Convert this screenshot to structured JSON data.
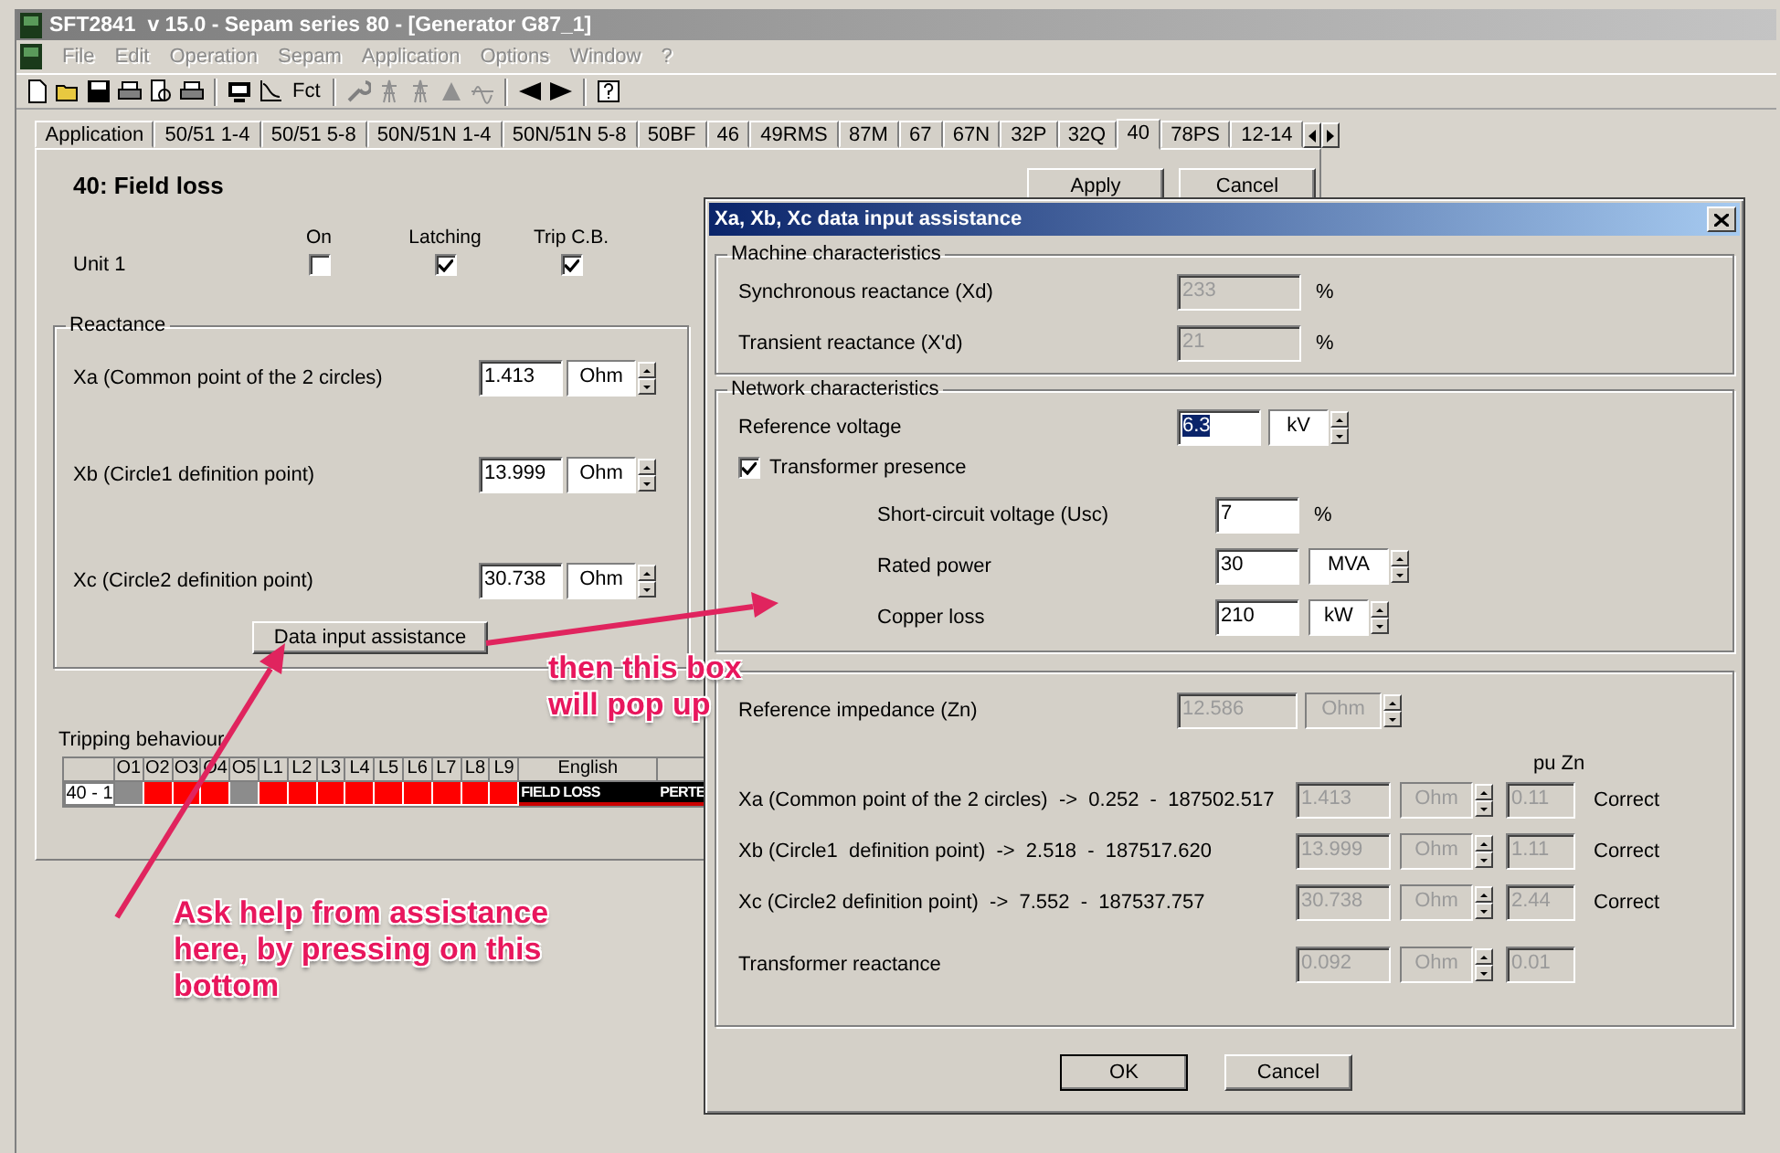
{
  "window": {
    "title": "SFT2841  v 15.0 - Sepam series 80 - [Generator G87_1]"
  },
  "menu": {
    "disabled": true,
    "items": [
      "File",
      "Edit",
      "Operation",
      "Sepam",
      "Application",
      "Options",
      "Window",
      "?"
    ]
  },
  "toolbar": {
    "function_label": "Fct"
  },
  "tabs": [
    {
      "label": "Application",
      "selected": false
    },
    {
      "label": "50/51 1-4",
      "selected": false
    },
    {
      "label": "50/51 5-8",
      "selected": false
    },
    {
      "label": "50N/51N 1-4",
      "selected": false
    },
    {
      "label": "50N/51N 5-8",
      "selected": false
    },
    {
      "label": "50BF",
      "selected": false
    },
    {
      "label": "46",
      "selected": false
    },
    {
      "label": "49RMS",
      "selected": false
    },
    {
      "label": "87M",
      "selected": false
    },
    {
      "label": "67",
      "selected": false
    },
    {
      "label": "67N",
      "selected": false
    },
    {
      "label": "32P",
      "selected": false
    },
    {
      "label": "32Q",
      "selected": false
    },
    {
      "label": "40",
      "selected": true
    },
    {
      "label": "78PS",
      "selected": false
    },
    {
      "label": "12-14",
      "selected": false
    }
  ],
  "panel": {
    "title": "40: Field loss",
    "apply": "Apply",
    "cancel": "Cancel",
    "unit_columns": [
      "On",
      "Latching",
      "Trip C.B."
    ],
    "units": [
      {
        "label": "Unit 1",
        "checks": [
          {
            "checked": false
          },
          {
            "checked": true
          },
          {
            "checked": true
          }
        ]
      }
    ],
    "reactance": {
      "title": "Reactance",
      "rows": [
        {
          "label": "Xa (Common point of the 2 circles)",
          "value": "1.413",
          "unit": "Ohm"
        },
        {
          "label": "Xb (Circle1 definition point)",
          "value": "13.999",
          "unit": "Ohm"
        },
        {
          "label": "Xc (Circle2 definition point)",
          "value": "30.738",
          "unit": "Ohm"
        }
      ]
    },
    "assist_button": "Data input assistance",
    "tripping": {
      "title": "Tripping behaviour",
      "columns": [
        "O1",
        "O2",
        "O3",
        "O4",
        "O5",
        "L1",
        "L2",
        "L3",
        "L4",
        "L5",
        "L6",
        "L7",
        "L8",
        "L9",
        "English"
      ],
      "rows": [
        {
          "label": "40 - 1",
          "cells": [
            {
              "color": "#8c8c8c"
            },
            {
              "color": "#ff0000"
            },
            {
              "color": "#ff0000"
            },
            {
              "color": "#ff0000"
            },
            {
              "color": "#8c8c8c"
            },
            {
              "color": "#ff0000"
            },
            {
              "color": "#ff0000"
            },
            {
              "color": "#ff0000"
            },
            {
              "color": "#ff0000"
            },
            {
              "color": "#ff0000"
            },
            {
              "color": "#ff0000"
            },
            {
              "color": "#ff0000"
            },
            {
              "color": "#ff0000"
            },
            {
              "color": "#ff0000"
            }
          ],
          "messages": [
            "FIELD LOSS",
            "PERTE"
          ]
        }
      ]
    }
  },
  "dialog": {
    "title": "Xa, Xb, Xc data input assistance",
    "machine": {
      "title": "Machine characteristics",
      "rows": [
        {
          "label": "Synchronous reactance (Xd)",
          "value": "233",
          "unit": "%",
          "disabled": true
        },
        {
          "label": "Transient reactance (X'd)",
          "value": "21",
          "unit": "%",
          "disabled": true
        }
      ]
    },
    "network": {
      "title": "Network characteristics",
      "reference": {
        "label": "Reference voltage",
        "value": "6.3",
        "unit": "kV",
        "selected": true
      },
      "transformer": {
        "label": "Transformer presence",
        "checked": true
      },
      "rows": [
        {
          "label": "Short-circuit voltage (Usc)",
          "value": "7",
          "unit": "%",
          "kind": "plain"
        },
        {
          "label": "Rated power",
          "value": "30",
          "unit": "MVA",
          "kind": "spin"
        },
        {
          "label": "Copper loss",
          "value": "210",
          "unit": "kW",
          "kind": "spin"
        }
      ]
    },
    "impedance": {
      "reference": {
        "label": "Reference impedance (Zn)",
        "value": "12.586",
        "unit": "Ohm",
        "disabled": true
      },
      "pu_header": "pu Zn",
      "rows": [
        {
          "label": "Xa (Common point of the 2 circles)  ->  0.252  -  187502.517",
          "value": "1.413",
          "unit": "Ohm",
          "pu": "0.11",
          "status": "Correct",
          "disabled": true
        },
        {
          "label": "Xb (Circle1  definition point)  ->  2.518  -  187517.620",
          "value": "13.999",
          "unit": "Ohm",
          "pu": "1.11",
          "status": "Correct",
          "disabled": true
        },
        {
          "label": "Xc (Circle2 definition point)  ->  7.552  -  187537.757",
          "value": "30.738",
          "unit": "Ohm",
          "pu": "2.44",
          "status": "Correct",
          "disabled": true
        },
        {
          "label": "Transformer reactance",
          "value": "0.092",
          "unit": "Ohm",
          "pu": "0.01",
          "disabled": true
        }
      ]
    },
    "buttons": [
      "OK",
      "Cancel"
    ]
  },
  "annotations": [
    {
      "text": "then this box\nwill pop up"
    },
    {
      "text": "Ask help from assistance\nhere, by pressing on this\nbottom"
    }
  ]
}
